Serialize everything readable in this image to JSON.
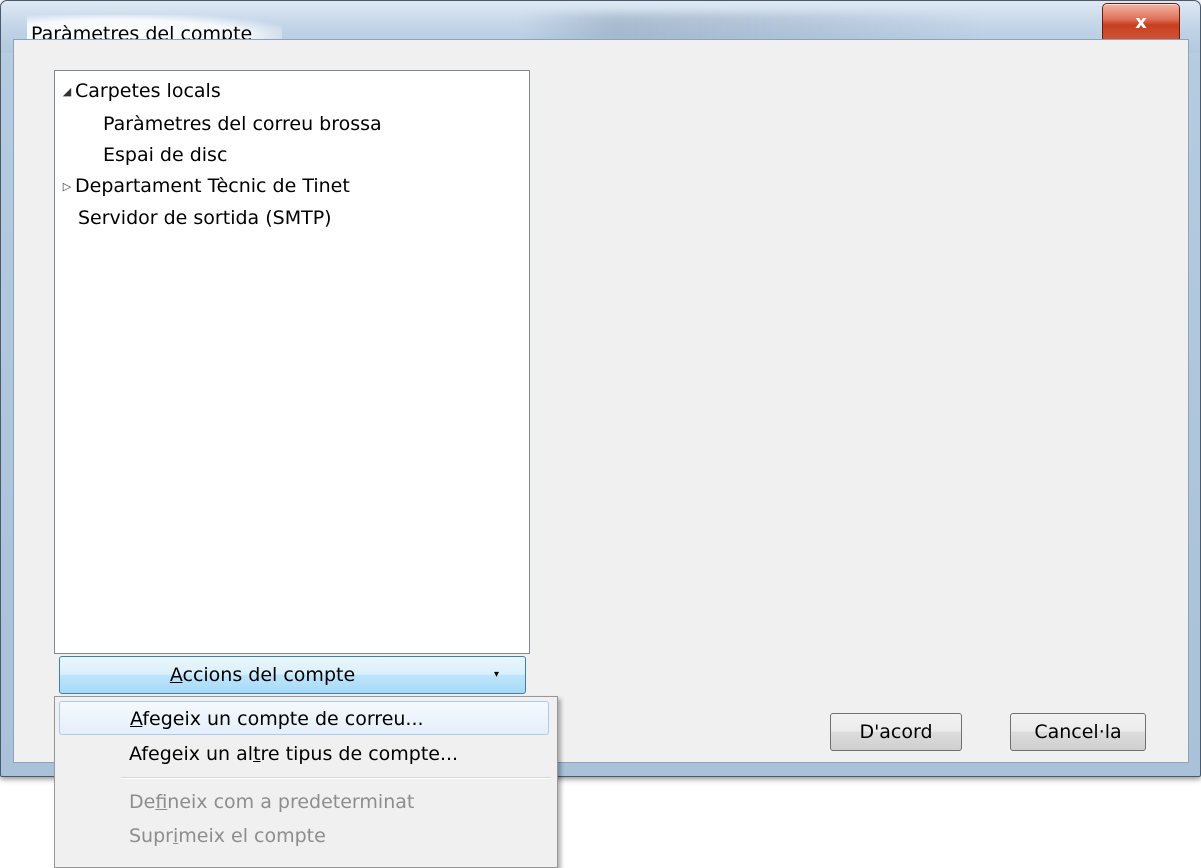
{
  "window": {
    "title": "Paràmetres del compte",
    "close_glyph": "x"
  },
  "tree": {
    "items": [
      {
        "label": "Carpetes locals",
        "toggle": "◢",
        "level": 0
      },
      {
        "label": "Paràmetres del correu brossa",
        "toggle": "",
        "level": 1
      },
      {
        "label": "Espai de disc",
        "toggle": "",
        "level": 1
      },
      {
        "label": "Departament Tècnic de Tinet",
        "toggle": "▷",
        "level": 0
      },
      {
        "label": "Servidor de sortida (SMTP)",
        "toggle": "",
        "level": 0
      }
    ]
  },
  "actions_button": {
    "mnemonic": "A",
    "rest": "ccions del compte",
    "arrow": "▾"
  },
  "menu": {
    "items": [
      {
        "pre": "",
        "mnemonic": "A",
        "post": "fegeix un compte de correu...",
        "disabled": false
      },
      {
        "pre": "Afegeix un al",
        "mnemonic": "t",
        "post": "re tipus de compte...",
        "disabled": false
      },
      {
        "pre": "De",
        "mnemonic": "f",
        "post": "ineix com a predeterminat",
        "disabled": true
      },
      {
        "pre": "Supr",
        "mnemonic": "i",
        "post": "meix el compte",
        "disabled": true
      }
    ]
  },
  "buttons": {
    "ok": "D'acord",
    "cancel": "Cancel·la"
  }
}
